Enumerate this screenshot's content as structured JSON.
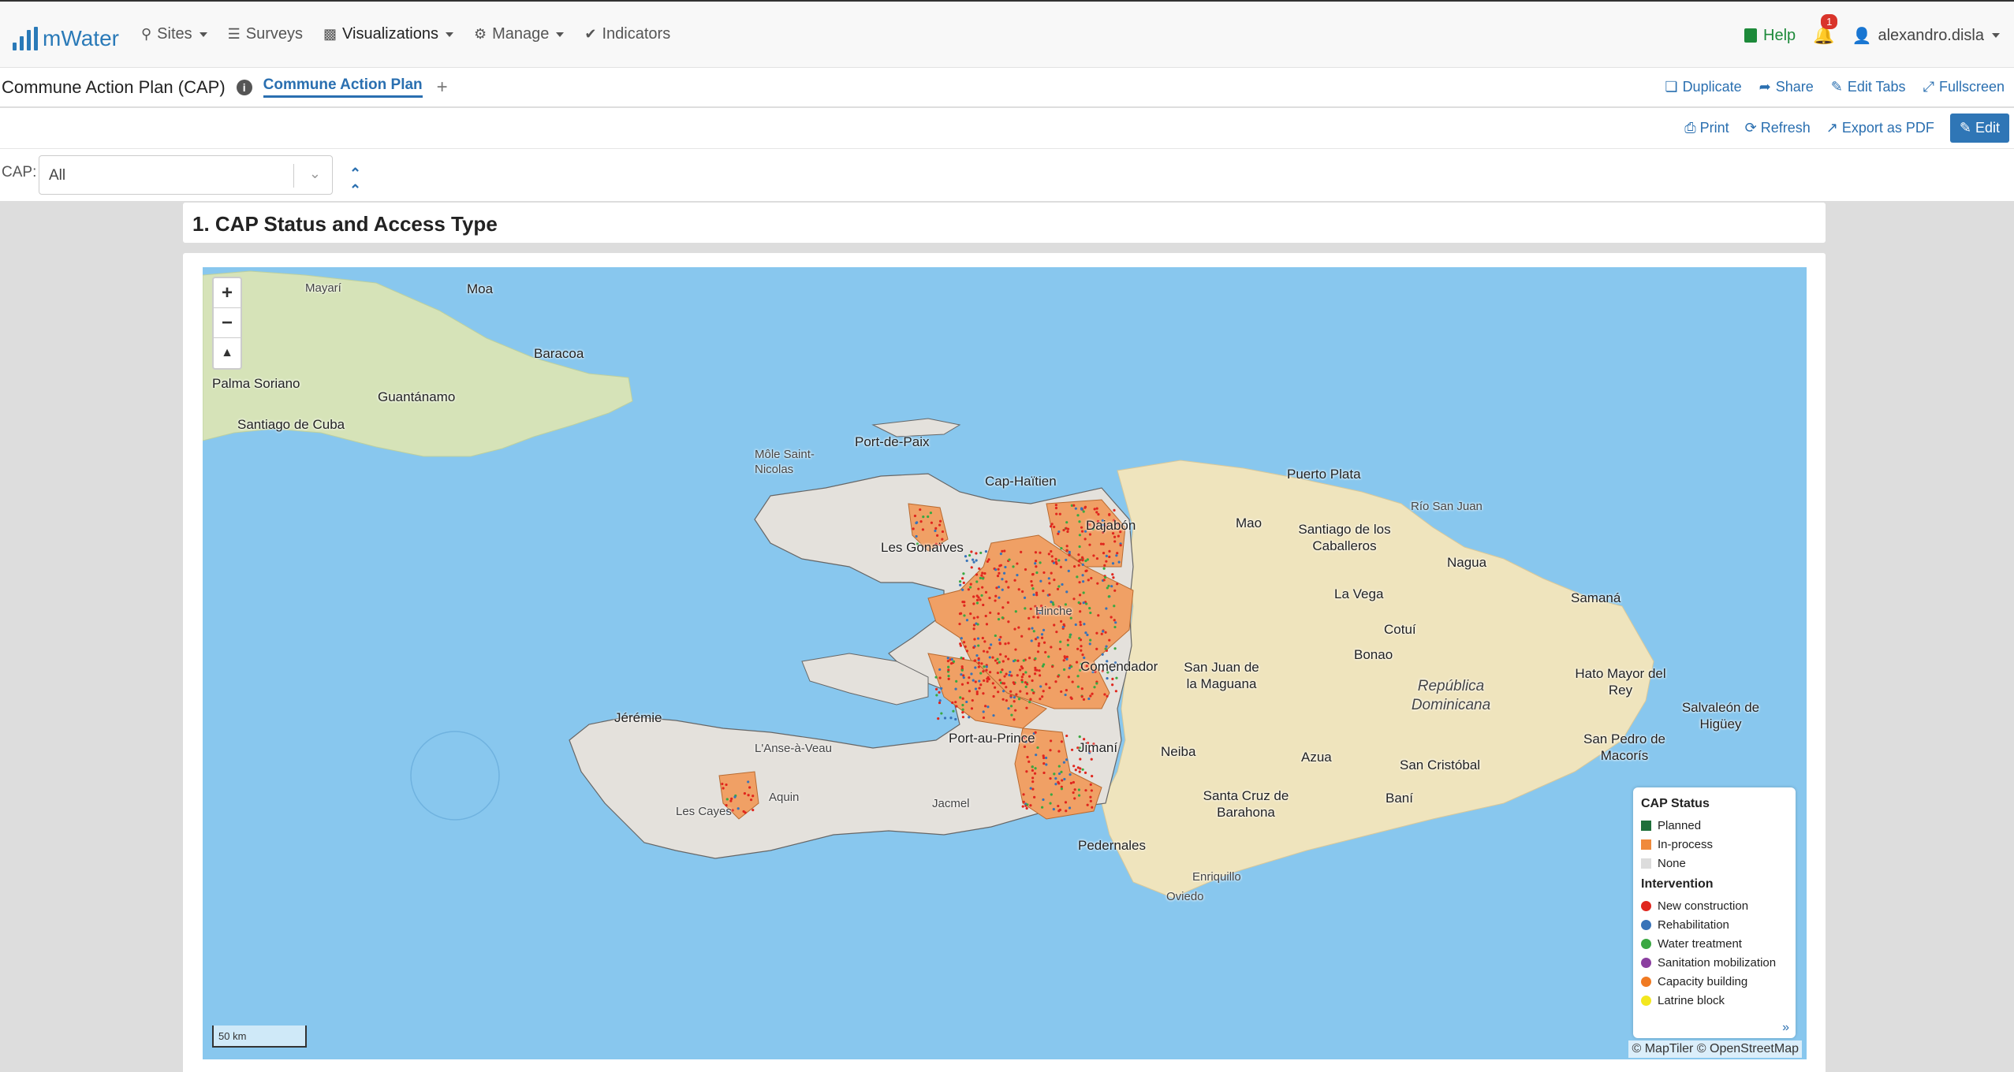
{
  "brand": {
    "name": "mWater"
  },
  "nav": {
    "items": [
      {
        "label": "Sites",
        "icon": "map-marker-icon",
        "dropdown": true
      },
      {
        "label": "Surveys",
        "icon": "list-icon",
        "dropdown": false
      },
      {
        "label": "Visualizations",
        "icon": "chart-icon",
        "dropdown": true
      },
      {
        "label": "Manage",
        "icon": "gear-icon",
        "dropdown": true
      },
      {
        "label": "Indicators",
        "icon": "check-circle-icon",
        "dropdown": false
      }
    ],
    "help": "Help",
    "notifications": "1",
    "user": "alexandro.disla"
  },
  "tabbar": {
    "title": "Commune Action Plan (CAP)",
    "active_tab": "Commune Action Plan",
    "actions": {
      "duplicate": "Duplicate",
      "share": "Share",
      "edit_tabs": "Edit Tabs",
      "fullscreen": "Fullscreen"
    }
  },
  "actionbar": {
    "print": "Print",
    "refresh": "Refresh",
    "export": "Export as PDF",
    "edit": "Edit"
  },
  "filter": {
    "label": "CAP:",
    "value": "All"
  },
  "section": {
    "title": "1. CAP Status and Access Type"
  },
  "map": {
    "places": {
      "moa": "Moa",
      "mayari": "Mayarí",
      "baracoa": "Baracoa",
      "palma": "Palma Soriano",
      "guantanamo": "Guantánamo",
      "santiago_cuba": "Santiago de Cuba",
      "port_de_paix": "Port-de-Paix",
      "mole": "Môle Saint-Nicolas",
      "cap_haitien": "Cap-Haïtien",
      "dajabon": "Dajabón",
      "gonaives": "Les Gonaïves",
      "puerto_plata": "Puerto Plata",
      "mao": "Mao",
      "santiago_caballeros": "Santiago de los Caballeros",
      "rio_san_juan": "Río San Juan",
      "nagua": "Nagua",
      "la_vega": "La Vega",
      "samana": "Samaná",
      "cotui": "Cotuí",
      "hinche": "Hinche",
      "comendador": "Comendador",
      "san_juan": "San Juan de la Maguana",
      "bonao": "Bonao",
      "rep_dom": "República Dominicana",
      "hato_mayor": "Hato Mayor del Rey",
      "salvaleon": "Salvaleón de Higüey",
      "jeremie": "Jérémie",
      "anse_a_veau": "L'Anse-à-Veau",
      "port_au_prince": "Port-au-Prince",
      "jimani": "Jimaní",
      "neiba": "Neiba",
      "azua": "Azua",
      "san_cristobal": "San Cristóbal",
      "san_pedro": "San Pedro de Macorís",
      "santa_cruz": "Santa Cruz de Barahona",
      "bani": "Baní",
      "les_cayes": "Les Cayes",
      "aquin": "Aquin",
      "jacmel": "Jacmel",
      "pedernales": "Pedernales",
      "enriquillo": "Enriquillo",
      "oviedo": "Oviedo"
    },
    "scale": "50 km",
    "attribution": "© MapTiler © OpenStreetMap",
    "colors": {
      "sea": "#88c7ee",
      "land": "#f3eccd",
      "haiti": "#e4e1dc",
      "inprocess": "#f0a065",
      "planned": "#1a7a36"
    }
  },
  "legend": {
    "status_title": "CAP Status",
    "status": [
      {
        "label": "Planned",
        "color": "#1f6f3a"
      },
      {
        "label": "In-process",
        "color": "#f08a3c"
      },
      {
        "label": "None",
        "color": "#dcdcdc"
      }
    ],
    "intervention_title": "Intervention",
    "interventions": [
      {
        "label": "New construction",
        "color": "#e0261e"
      },
      {
        "label": "Rehabilitation",
        "color": "#3873b8"
      },
      {
        "label": "Water treatment",
        "color": "#3aa842"
      },
      {
        "label": "Sanitation mobilization",
        "color": "#8b3fa0"
      },
      {
        "label": "Capacity building",
        "color": "#f07a22"
      },
      {
        "label": "Latrine block",
        "color": "#f3e71f"
      }
    ]
  }
}
